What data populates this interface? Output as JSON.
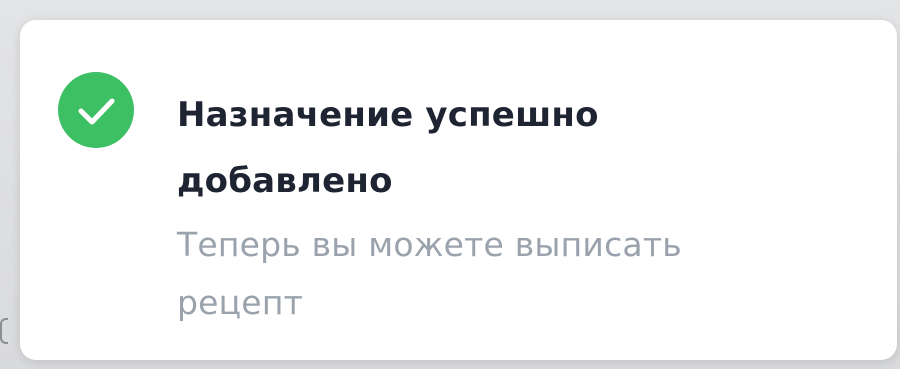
{
  "toast": {
    "icon": "check-circle-icon",
    "title": "Назначение успешно добавлено",
    "message": "Теперь вы можете выписать рецепт",
    "colors": {
      "success": "#3dbf64",
      "title": "#1f2433",
      "message": "#9aa3ad",
      "background": "#ffffff"
    }
  }
}
